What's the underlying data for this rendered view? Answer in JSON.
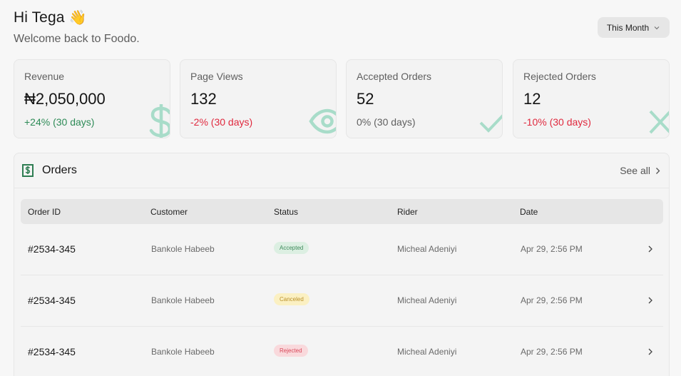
{
  "header": {
    "greeting": "Hi Tega",
    "greeting_emoji": "👋",
    "subtitle": "Welcome back to Foodo."
  },
  "period_select": {
    "label": "This Month"
  },
  "stats": [
    {
      "label": "Revenue",
      "value": "₦2,050,000",
      "delta": "+24% (30 days)",
      "trend": "up",
      "icon": "dollar-icon"
    },
    {
      "label": "Page Views",
      "value": "132",
      "delta": "-2% (30 days)",
      "trend": "down",
      "icon": "eye-icon"
    },
    {
      "label": "Accepted Orders",
      "value": "52",
      "delta": "0% (30 days)",
      "trend": "flat",
      "icon": "check-icon"
    },
    {
      "label": "Rejected Orders",
      "value": "12",
      "delta": "-10% (30 days)",
      "trend": "down",
      "icon": "x-icon"
    }
  ],
  "orders": {
    "title": "Orders",
    "see_all": "See all",
    "columns": [
      "Order ID",
      "Customer",
      "Status",
      "Rider",
      "Date"
    ],
    "rows": [
      {
        "id": "#2534-345",
        "customer": "Bankole Habeeb",
        "status": "Accepted",
        "rider": "Micheal Adeniyi",
        "date": "Apr 29, 2:56 PM"
      },
      {
        "id": "#2534-345",
        "customer": "Bankole Habeeb",
        "status": "Canceled",
        "rider": "Micheal Adeniyi",
        "date": "Apr 29, 2:56 PM"
      },
      {
        "id": "#2534-345",
        "customer": "Bankole Habeeb",
        "status": "Rejected",
        "rider": "Micheal Adeniyi",
        "date": "Apr 29, 2:56 PM"
      }
    ]
  },
  "colors": {
    "accent_green": "#2e8b57",
    "negative_red": "#e0293e",
    "icon_mint": "#a8dcc9"
  }
}
